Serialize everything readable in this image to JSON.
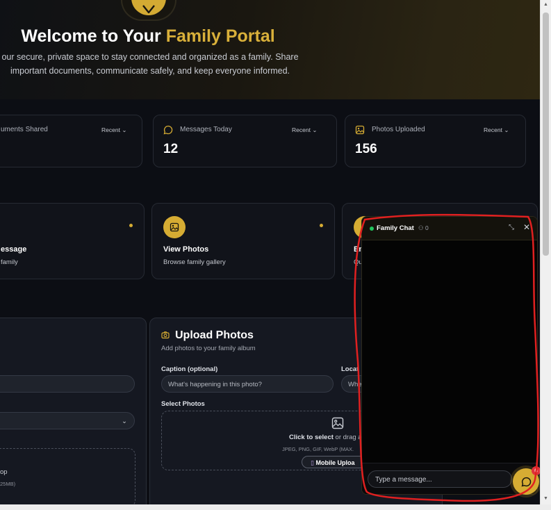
{
  "hero": {
    "title_prefix": "Welcome to Your ",
    "title_accent": "Family Portal",
    "subtitle_line1": "our secure, private space to stay connected and organized as a family. Share",
    "subtitle_line2": "important documents, communicate safely, and keep everyone informed."
  },
  "stats": [
    {
      "label": "uments Shared",
      "filter": "Recent",
      "value": ""
    },
    {
      "label": "Messages Today",
      "filter": "Recent",
      "value": "12"
    },
    {
      "label": "Photos Uploaded",
      "filter": "Recent",
      "value": "156"
    }
  ],
  "actions": [
    {
      "title": "essage",
      "subtitle": "family"
    },
    {
      "title": "View Photos",
      "subtitle": "Browse family gallery"
    },
    {
      "title": "Em",
      "subtitle": "Qu"
    }
  ],
  "upload": {
    "title": "Upload Photos",
    "subtitle": "Add photos to your family album",
    "caption_label": "Caption (optional)",
    "caption_placeholder": "What's happening in this photo?",
    "location_label": "Locat",
    "location_placeholder": "Whe",
    "select_label": "Select Photos",
    "drop_text_a": "Click to select",
    "drop_text_b": " or drag a",
    "drop_formats": "JPEG, PNG, GIF, WebP (MAX.",
    "mobile_button": "Mobile Uploa"
  },
  "left_panel": {
    "drop_text": "op",
    "drop_sub": "25MB)"
  },
  "chat": {
    "title": "Family Chat",
    "members": "0",
    "input_placeholder": "Type a message...",
    "badge": "6"
  },
  "colors": {
    "accent": "#d6ac33",
    "online": "#22c55e",
    "badge": "#e0323a"
  }
}
